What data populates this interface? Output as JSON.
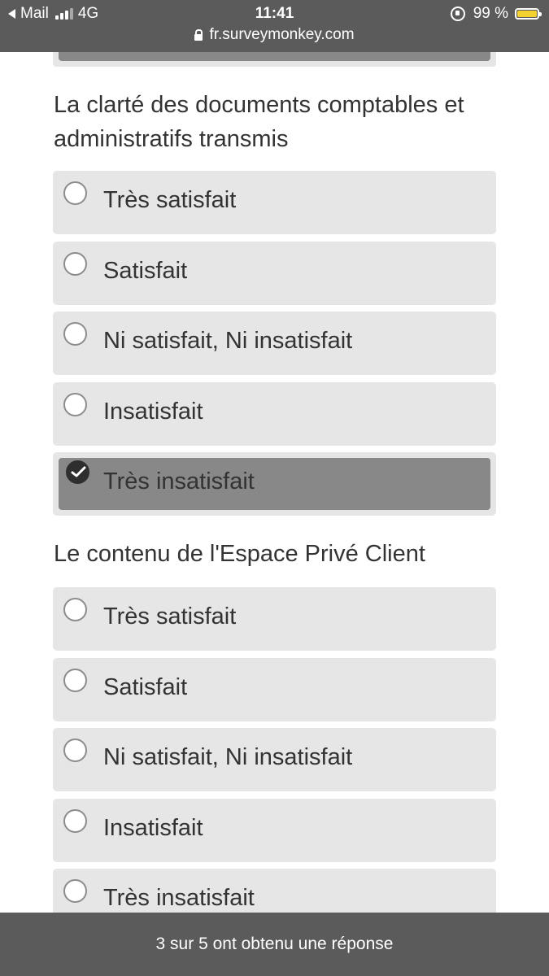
{
  "status_bar": {
    "back_app": "Mail",
    "network": "4G",
    "time": "11:41",
    "battery": "99 %",
    "battery_level": 0.99
  },
  "url_bar": {
    "url": "fr.surveymonkey.com"
  },
  "questions": [
    {
      "title": "La clarté des documents comptables et administratifs transmis",
      "options": [
        "Très satisfait",
        "Satisfait",
        "Ni satisfait, Ni insatisfait",
        "Insatisfait",
        "Très insatisfait"
      ],
      "selected": "Très insatisfait"
    },
    {
      "title": "Le contenu de l'Espace Privé Client",
      "options": [
        "Très satisfait",
        "Satisfait",
        "Ni satisfait, Ni insatisfait",
        "Insatisfait",
        "Très insatisfait"
      ],
      "selected": null
    }
  ],
  "footer": {
    "progress_text": "3 sur 5 ont obtenu une réponse",
    "answered": 3,
    "total": 5
  },
  "colors": {
    "bar_bg": "#5b5b5b",
    "option_bg": "#e6e6e6",
    "selected_bg": "#888888",
    "battery": "#f5d130"
  }
}
